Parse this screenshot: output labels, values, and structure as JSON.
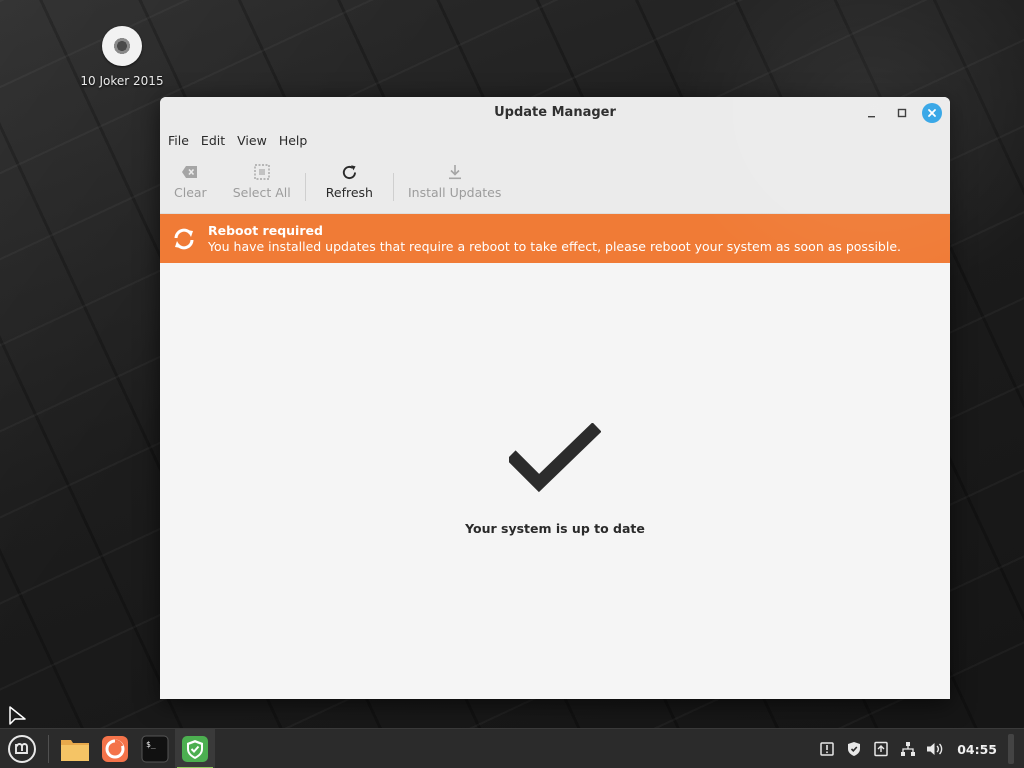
{
  "desktop": {
    "icon_label": "10 Joker 2015"
  },
  "window": {
    "title": "Update Manager",
    "controls": {
      "minimize": "minimize-icon",
      "maximize": "maximize-icon",
      "close": "close-icon"
    },
    "menu": [
      "File",
      "Edit",
      "View",
      "Help"
    ],
    "toolbar": {
      "clear": {
        "label": "Clear",
        "icon": "backspace-icon",
        "enabled": false
      },
      "select_all": {
        "label": "Select All",
        "icon": "select-all-icon",
        "enabled": false
      },
      "refresh": {
        "label": "Refresh",
        "icon": "refresh-icon",
        "enabled": true
      },
      "install": {
        "label": "Install Updates",
        "icon": "download-icon",
        "enabled": false
      }
    },
    "banner": {
      "title": "Reboot required",
      "message": "You have installed updates that require a reboot to take effect, please reboot your system as soon as possible.",
      "color": "#f07b36"
    },
    "status": {
      "message": "Your system is up to date",
      "icon": "checkmark-icon"
    }
  },
  "taskbar": {
    "launchers": [
      "mint-menu-icon",
      "files-icon",
      "firefox-icon",
      "terminal-icon",
      "update-manager-icon"
    ],
    "tray": [
      "notification-icon",
      "shield-icon",
      "update-icon",
      "network-icon",
      "volume-icon"
    ],
    "clock": "04:55"
  },
  "colors": {
    "accent_blue": "#2fa3e6",
    "banner_orange": "#f07b36",
    "mint_green": "#8fc95d"
  }
}
